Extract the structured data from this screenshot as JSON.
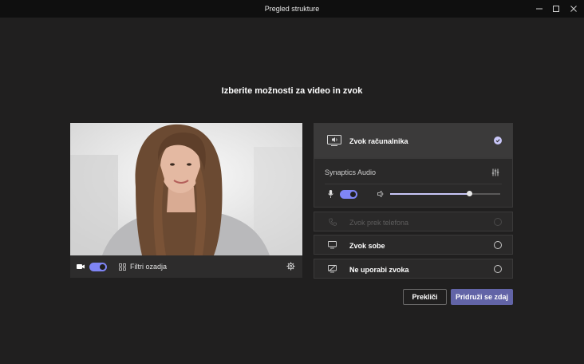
{
  "window": {
    "title": "Pregled strukture"
  },
  "heading": "Izberite možnosti za video in zvok",
  "video": {
    "camera_toggle_on": true,
    "background_filters_label": "Filtri ozadja"
  },
  "audio": {
    "computer_audio": {
      "label": "Zvok računalnika",
      "selected": true
    },
    "device_name": "Synaptics Audio",
    "mic_toggle_on": true,
    "speaker_volume": 0.72,
    "phone_audio": {
      "label": "Zvok prek telefona",
      "disabled": true
    },
    "room_audio": {
      "label": "Zvok sobe"
    },
    "no_audio": {
      "label": "Ne uporabi zvoka"
    }
  },
  "buttons": {
    "cancel": "Prekliči",
    "join": "Pridruži se zdaj"
  },
  "colors": {
    "accent": "#7f85f5",
    "join_button": "#6264a7",
    "background": "#201f1f",
    "titlebar": "#0f0f0f"
  }
}
